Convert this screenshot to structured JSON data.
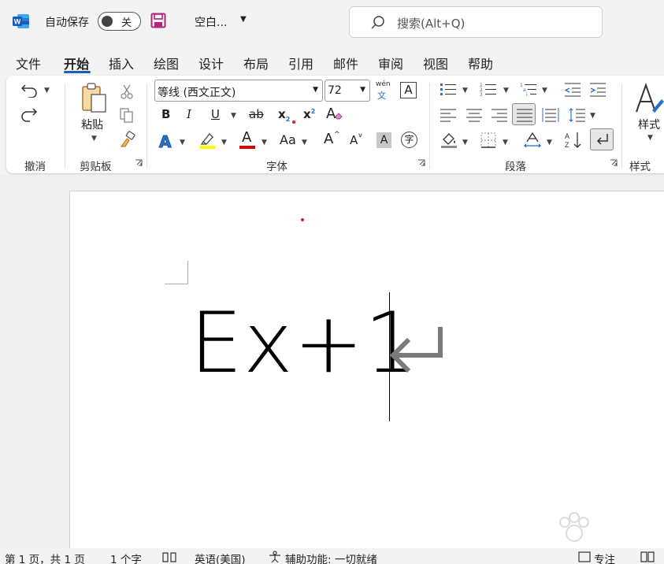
{
  "titlebar": {
    "autosave_label": "自动保存",
    "autosave_state": "关",
    "doc_title": "空白...",
    "search_placeholder": "搜索(Alt+Q)"
  },
  "tabs": [
    {
      "label": "文件"
    },
    {
      "label": "开始",
      "active": true
    },
    {
      "label": "插入"
    },
    {
      "label": "绘图"
    },
    {
      "label": "设计"
    },
    {
      "label": "布局"
    },
    {
      "label": "引用"
    },
    {
      "label": "邮件"
    },
    {
      "label": "审阅"
    },
    {
      "label": "视图"
    },
    {
      "label": "帮助"
    }
  ],
  "ribbon": {
    "groups": {
      "undo": "撤消",
      "clipboard": "剪贴板",
      "font": "字体",
      "paragraph": "段落",
      "styles": "样式"
    },
    "paste_label": "粘贴",
    "styles_button_label": "样式",
    "font_name": "等线 (西文正文)",
    "font_size": "72",
    "phonetic_top": "wén",
    "phonetic_bottom": "文",
    "bold": "B",
    "italic": "I",
    "underline": "U",
    "strike": "ab",
    "subscript": "x",
    "subscript_sub": "2",
    "superscript": "x",
    "superscript_sup": "2",
    "case": "Aa",
    "grow_font": "A",
    "shrink_font": "A",
    "char_shading": "A",
    "enclose_char": "字",
    "text_effects": "A",
    "font_color": "A",
    "clear_format": "A",
    "char_border": "A"
  },
  "document": {
    "text": "Ex+1"
  },
  "statusbar": {
    "page": "第 1 页，共 1 页",
    "words": "1 个字",
    "language": "英语(美国)",
    "accessibility": "辅助功能: 一切就绪",
    "focus": "专注"
  },
  "colors": {
    "accent": "#1b5eb3",
    "highlight": "#ffff00",
    "font_color": "#e00000",
    "word_blue": "#185abd"
  }
}
